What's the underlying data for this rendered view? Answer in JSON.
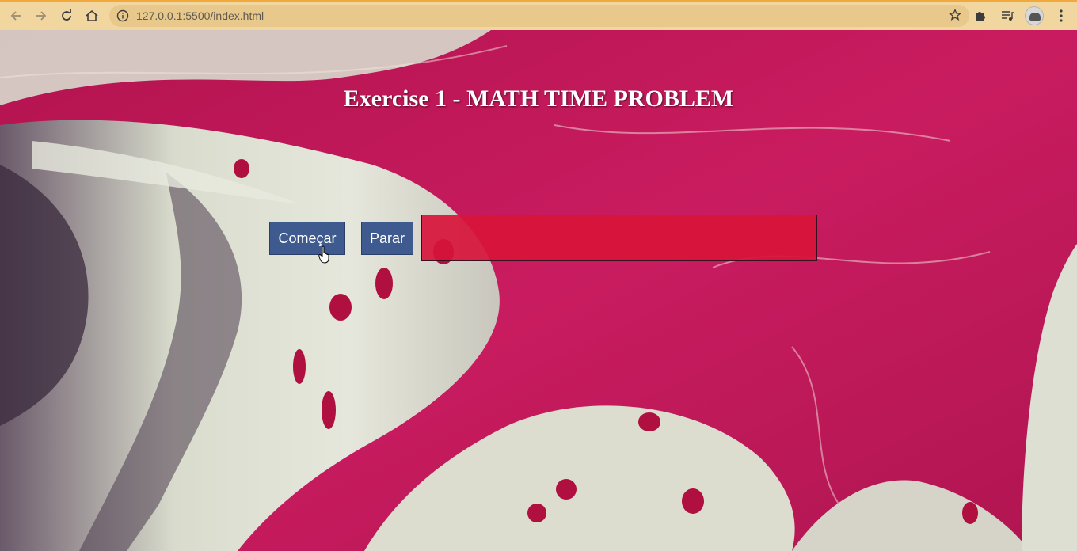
{
  "browser": {
    "url": "127.0.0.1:5500/index.html",
    "icons": {
      "back": "back-arrow-icon",
      "forward": "forward-arrow-icon",
      "reload": "reload-icon",
      "home": "home-icon",
      "info": "info-icon",
      "bookmark": "star-icon",
      "extensions": "puzzle-icon",
      "media": "playlist-icon",
      "profile": "avatar",
      "menu": "kebab-menu-icon"
    }
  },
  "page": {
    "title": "Exercise 1 - MATH TIME PROBLEM",
    "start_button": "Começar",
    "stop_button": "Parar",
    "display_value": ""
  },
  "colors": {
    "chrome_bg": "#f1d6a0",
    "omnibox_bg": "#e9c98b",
    "button_bg": "#3e5a8e",
    "display_bg": "#d7143a",
    "background_accent": "#c4185a"
  }
}
